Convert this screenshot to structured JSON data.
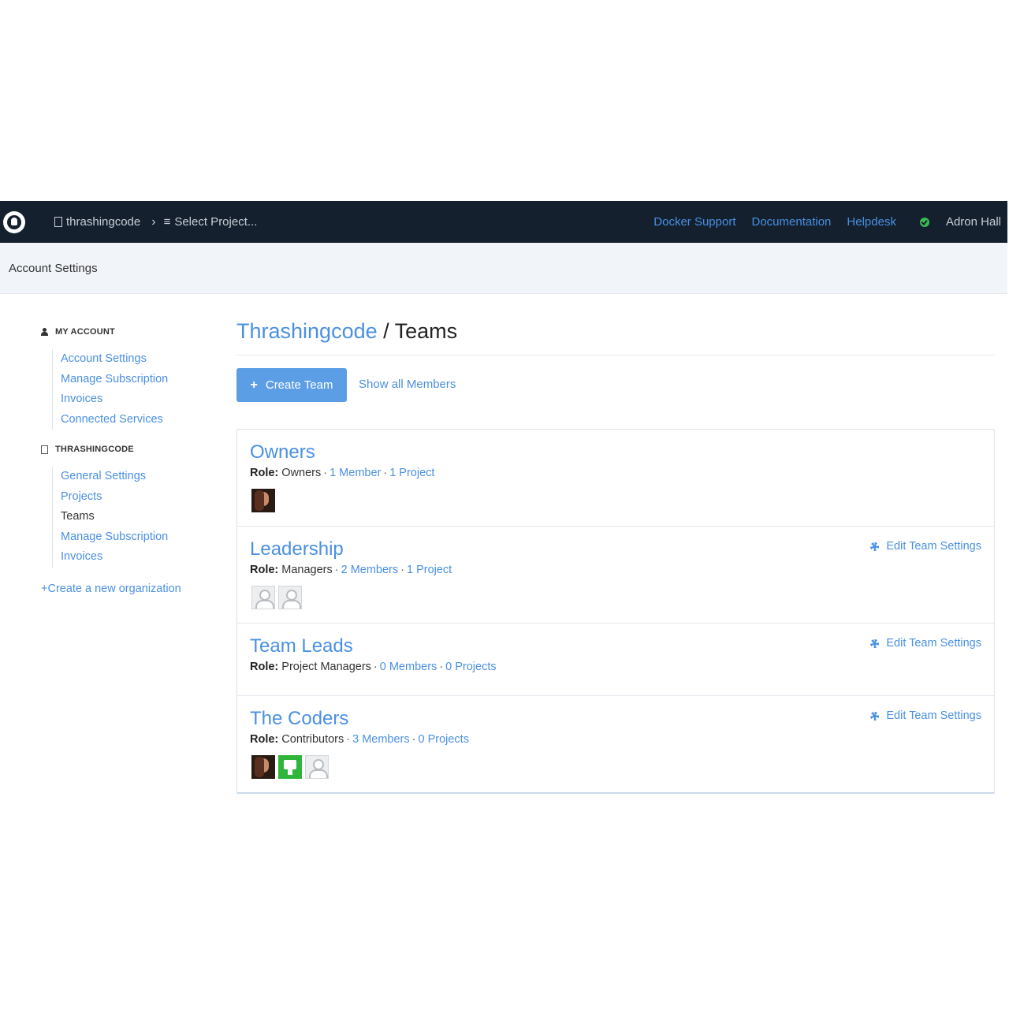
{
  "topbar": {
    "org_name": "thrashingcode",
    "project_select": "Select Project...",
    "links": [
      "Docker Support",
      "Documentation",
      "Helpdesk"
    ],
    "user_name": "Adron Hall",
    "status_color": "#3cba54"
  },
  "subheader": {
    "title": "Account Settings"
  },
  "sidebar": {
    "my_account": {
      "heading": "MY ACCOUNT",
      "items": [
        {
          "label": "Account Settings"
        },
        {
          "label": "Manage Subscription"
        },
        {
          "label": "Invoices"
        },
        {
          "label": "Connected Services"
        }
      ]
    },
    "organization": {
      "heading": "THRASHINGCODE",
      "items": [
        {
          "label": "General Settings"
        },
        {
          "label": "Projects"
        },
        {
          "label": "Teams",
          "active": true
        },
        {
          "label": "Manage Subscription"
        },
        {
          "label": "Invoices"
        }
      ]
    },
    "create_org": "Create a new organization"
  },
  "main": {
    "title_org": "Thrashingcode",
    "title_sep": " / Teams",
    "create_team": "Create Team",
    "show_all": "Show all Members",
    "role_label": "Role:",
    "edit_label": "Edit Team Settings",
    "teams": [
      {
        "name": "Owners",
        "role": "Owners",
        "members": "1 Member",
        "projects": "1 Project",
        "editable": false,
        "avatars": [
          "photo"
        ]
      },
      {
        "name": "Leadership",
        "role": "Managers",
        "members": "2 Members",
        "projects": "1 Project",
        "editable": true,
        "avatars": [
          "blank",
          "blank"
        ]
      },
      {
        "name": "Team Leads",
        "role": "Project Managers",
        "members": "0 Members",
        "projects": "0 Projects",
        "editable": true,
        "avatars": []
      },
      {
        "name": "The Coders",
        "role": "Contributors",
        "members": "3 Members",
        "projects": "0 Projects",
        "editable": true,
        "avatars": [
          "photo",
          "green",
          "blank"
        ]
      }
    ]
  },
  "colors": {
    "nav_bg": "#14202e",
    "accent": "#4a90e2",
    "button": "#5b9ee6"
  }
}
